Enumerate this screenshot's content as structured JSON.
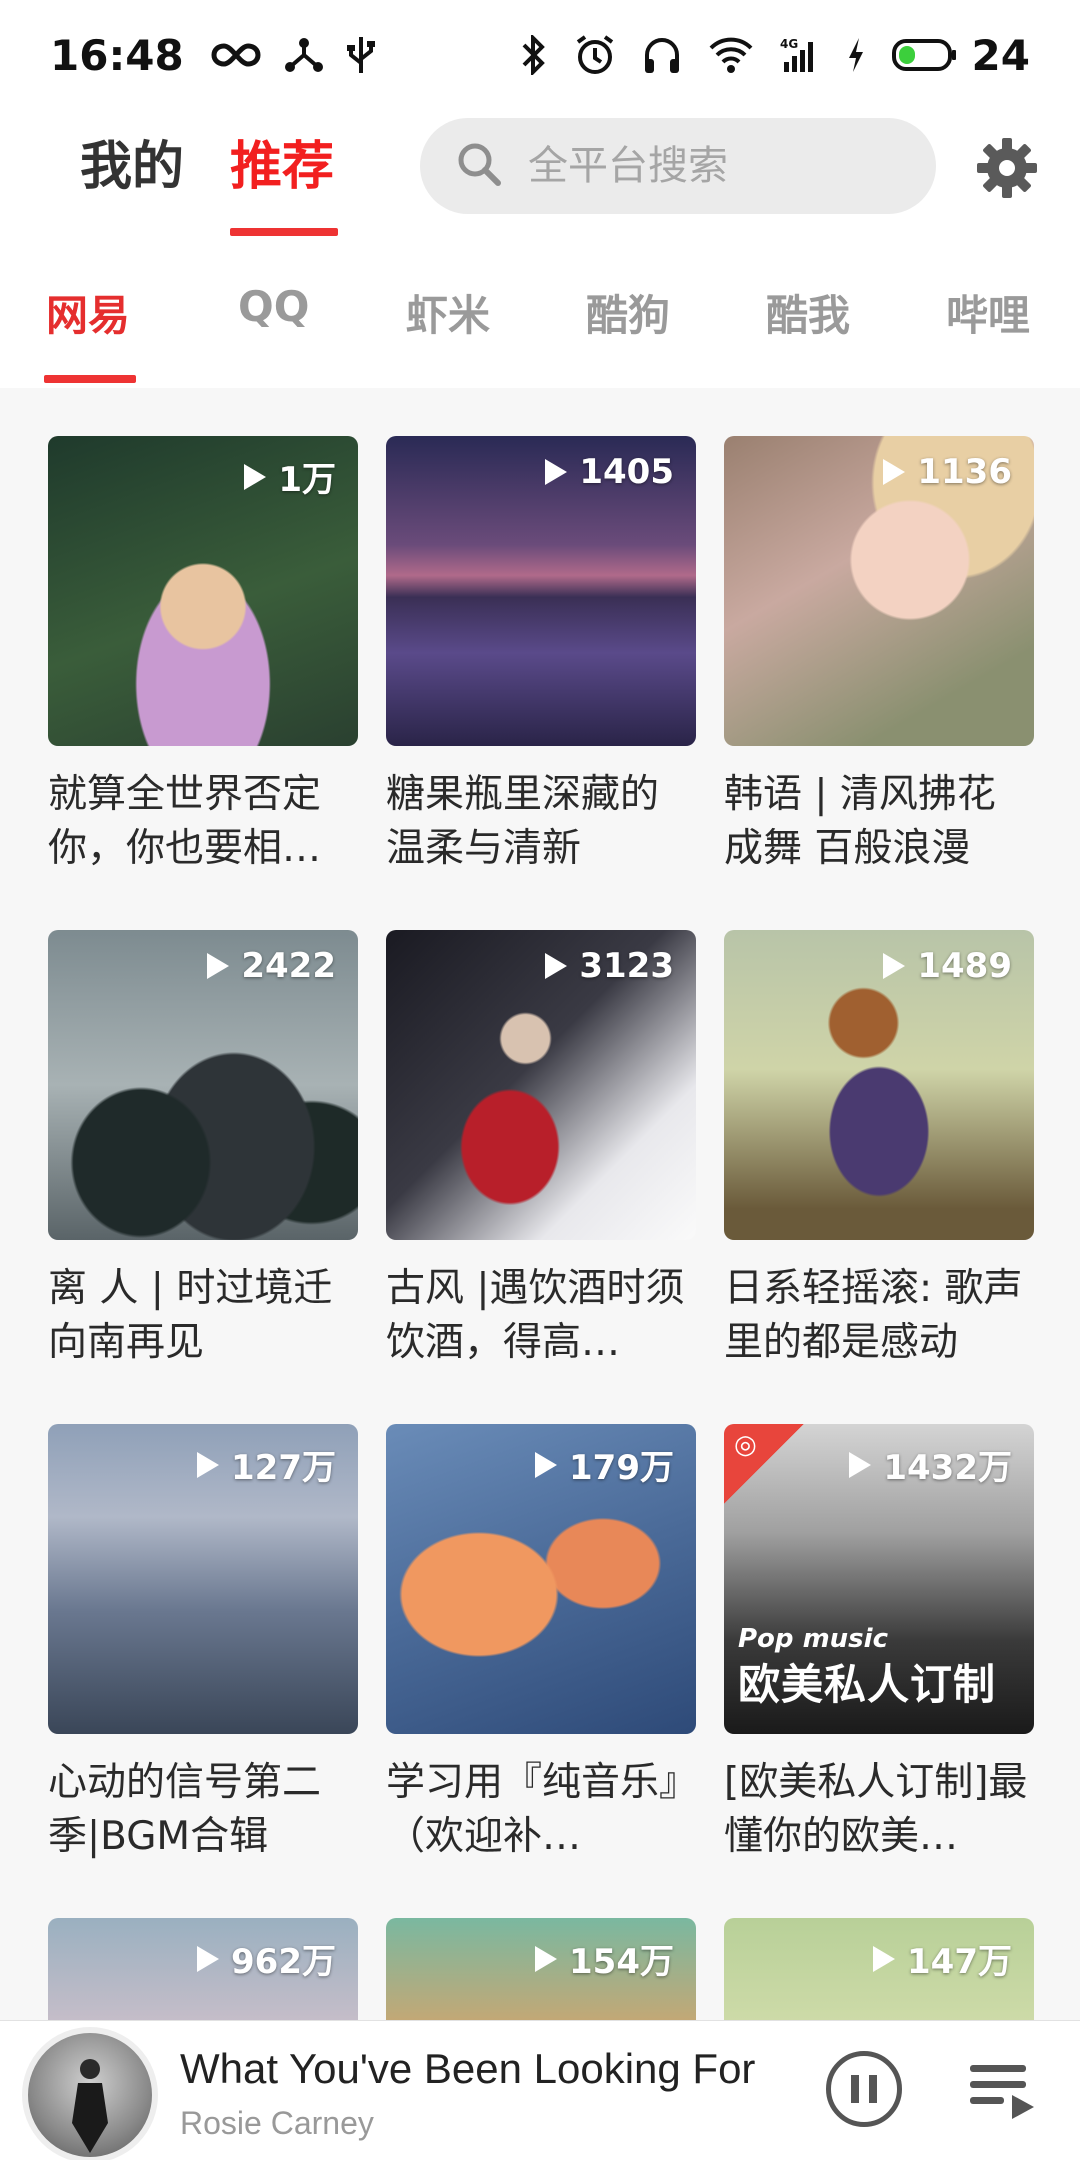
{
  "status_bar": {
    "time": "16:48",
    "battery": "24"
  },
  "header": {
    "tabs": [
      {
        "label": "我的"
      },
      {
        "label": "推荐"
      }
    ],
    "search_placeholder": "全平台搜索"
  },
  "platforms": [
    "网易",
    "QQ",
    "虾米",
    "酷狗",
    "酷我",
    "哔哩"
  ],
  "playlists": [
    {
      "count": "1万",
      "title": "就算全世界否定你，你也要相…"
    },
    {
      "count": "1405",
      "title": "糖果瓶里深藏的温柔与清新"
    },
    {
      "count": "1136",
      "title": "韩语 | 清风拂花成舞 百般浪漫"
    },
    {
      "count": "2422",
      "title": "离 人 | 时过境迁向南再见"
    },
    {
      "count": "3123",
      "title": "古风 |遇饮酒时须饮酒，得高…"
    },
    {
      "count": "1489",
      "title": "日系轻摇滚: 歌声里的都是感动"
    },
    {
      "count": "127万",
      "title": "心动的信号第二季|BGM合辑"
    },
    {
      "count": "179万",
      "title": "学习用『纯音乐』（欢迎补…"
    },
    {
      "count": "1432万",
      "title": "[欧美私人订制]最懂你的欧美…",
      "overlay_sub": "Pop music",
      "overlay_title": "欧美私人订制"
    },
    {
      "count": "962万",
      "title": ""
    },
    {
      "count": "154万",
      "title": ""
    },
    {
      "count": "147万",
      "title": ""
    }
  ],
  "player": {
    "title": "What You've Been Looking For",
    "artist": "Rosie Carney"
  },
  "colors": {
    "accent": "#ee3333",
    "background": "#f7f7f7"
  }
}
